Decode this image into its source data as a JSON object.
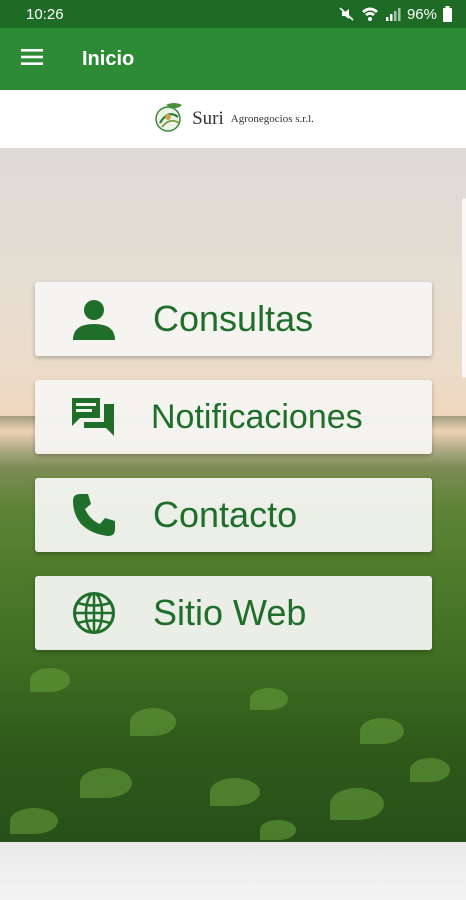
{
  "status_bar": {
    "time": "10:26",
    "battery": "96%",
    "icons": [
      "mute-icon",
      "wifi-icon",
      "signal-icon",
      "battery-icon"
    ]
  },
  "app_bar": {
    "title": "Inicio",
    "menu_icon": "hamburger-menu-icon"
  },
  "logo": {
    "brand": "Suri",
    "subtitle": "Agronegocios s.r.l."
  },
  "menu": [
    {
      "label": "Consultas",
      "icon": "person-icon"
    },
    {
      "label": "Notificaciones",
      "icon": "chat-icon"
    },
    {
      "label": "Contacto",
      "icon": "phone-icon"
    },
    {
      "label": "Sitio Web",
      "icon": "globe-icon"
    }
  ],
  "colors": {
    "status_bar": "#1e6b26",
    "app_bar": "#2e8b35",
    "accent_text": "#1f6e2a"
  }
}
